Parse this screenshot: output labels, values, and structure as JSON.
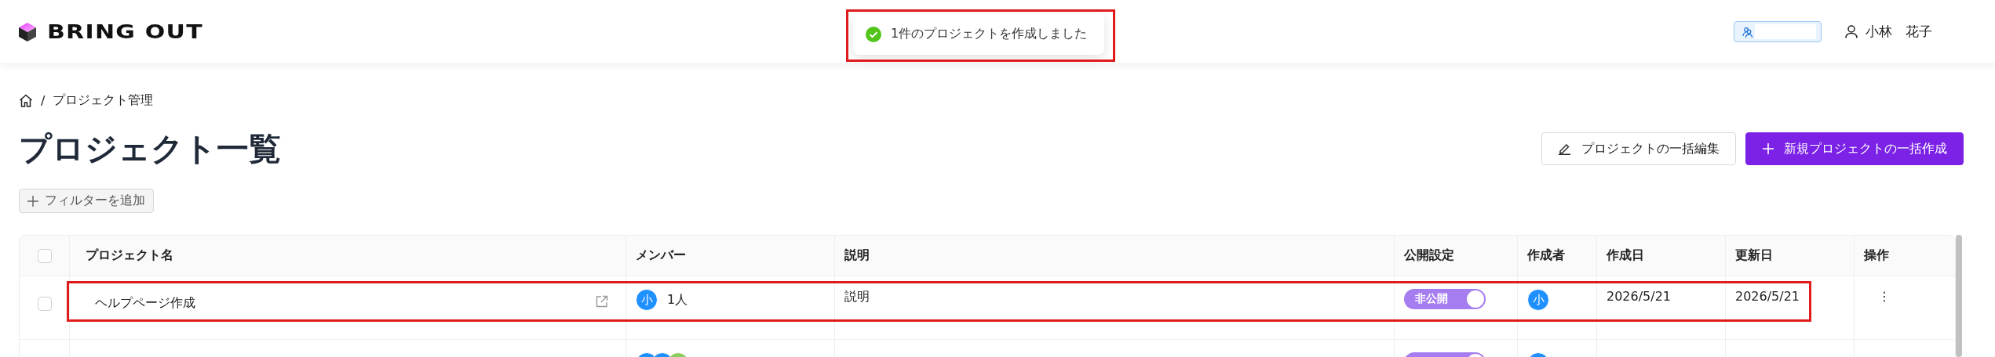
{
  "header": {
    "logo": "BRING OUT",
    "user_name": "小林　花子"
  },
  "toast": {
    "message": "1件のプロジェクトを作成しました",
    "highlighted": true
  },
  "breadcrumb_separator": "/",
  "breadcrumb": [
    "プロジェクト管理"
  ],
  "title": "プロジェクト一覧",
  "actions": [
    {
      "label": "プロジェクトの一括編集",
      "kind": "secondary"
    },
    {
      "label": "新規プロジェクトの一括作成",
      "kind": "primary"
    }
  ],
  "filter_button": "フィルターを追加",
  "table": {
    "select_all_checked": false,
    "columns": [
      "プロジェクト名",
      "メンバー",
      "説明",
      "公開設定",
      "作成者",
      "作成日",
      "更新日",
      "操作"
    ],
    "rows": [
      {
        "checked": false,
        "highlighted": true,
        "name": "ヘルプページ作成",
        "members": [
          {
            "initial": "小",
            "color": "#1e90ff"
          }
        ],
        "member_count": "1人",
        "description": "説明",
        "public": false,
        "public_label": "非公開",
        "creator": "小",
        "created": "2026/5/21",
        "updated": "2026/5/21",
        "menu": "⋮"
      },
      {
        "highlighted": false,
        "members": [
          {
            "color": "#1e90ff"
          },
          {
            "color": "#1e90ff"
          },
          {
            "color": "#8ccc5e"
          }
        ],
        "public": false
      }
    ]
  }
}
